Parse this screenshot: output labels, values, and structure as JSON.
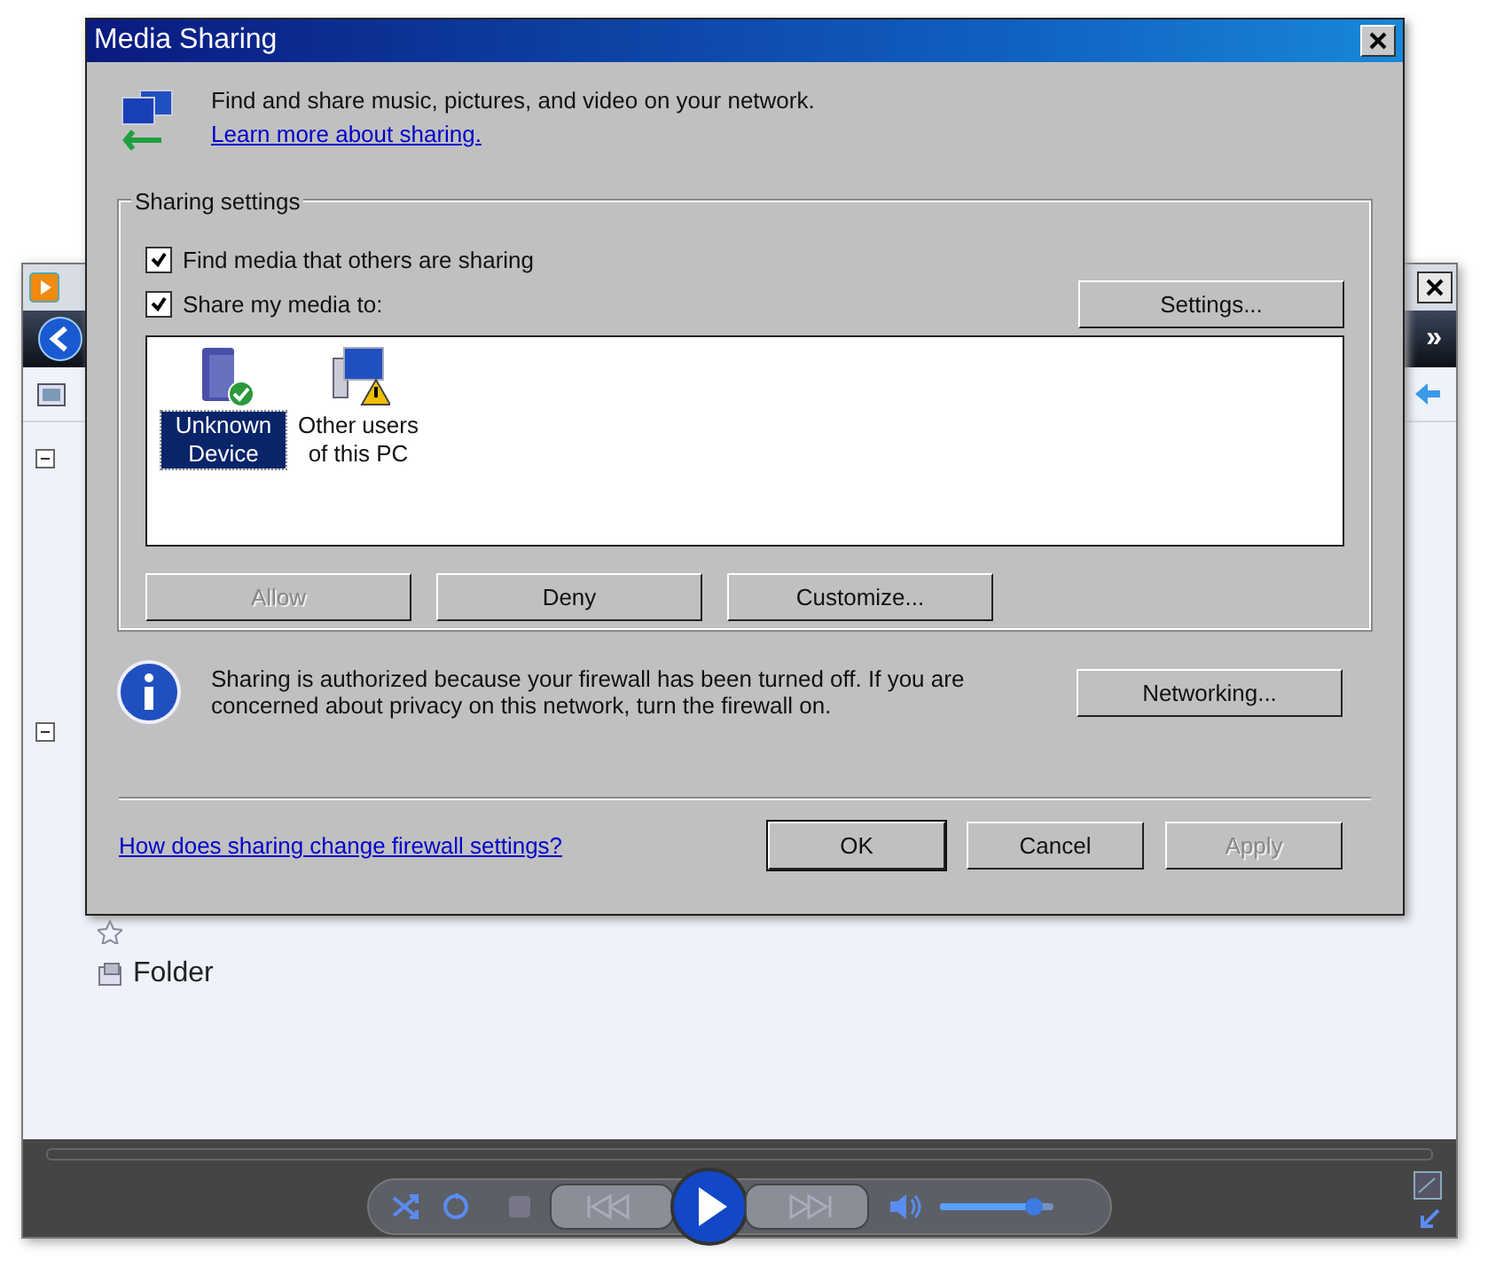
{
  "player_window": {
    "tree_toggles": [
      {
        "expanded": true
      },
      {
        "expanded": true
      }
    ],
    "library_items": [
      {
        "kind": "star"
      },
      {
        "kind": "folder",
        "label": "Folder"
      }
    ],
    "nav_more": "»",
    "volume": {
      "level": 0.9
    }
  },
  "dialog": {
    "title": "Media Sharing",
    "intro": "Find and share music, pictures, and video on your network.",
    "learn_link": "Learn more about sharing.",
    "group_title": "Sharing settings",
    "options": [
      {
        "label": "Find media that others are sharing",
        "checked": true
      },
      {
        "label": "Share my media to:",
        "checked": true
      }
    ],
    "settings_button": "Settings...",
    "devices": [
      {
        "label": "Unknown Device",
        "kind": "allowed",
        "selected": true
      },
      {
        "label": "Other users of this PC",
        "kind": "warning",
        "selected": false
      }
    ],
    "device_buttons": [
      {
        "label": "Allow",
        "disabled": true
      },
      {
        "label": "Deny",
        "disabled": false
      },
      {
        "label": "Customize...",
        "disabled": false
      }
    ],
    "info": "Sharing is authorized because your firewall has been turned off. If you are concerned about privacy on this network, turn the firewall on.",
    "networking_button": "Networking...",
    "help_link": "How does sharing change firewall settings?",
    "footer_buttons": [
      {
        "label": "OK",
        "disabled": false,
        "default": true
      },
      {
        "label": "Cancel",
        "disabled": false,
        "default": false
      },
      {
        "label": "Apply",
        "disabled": true,
        "default": false
      }
    ]
  }
}
